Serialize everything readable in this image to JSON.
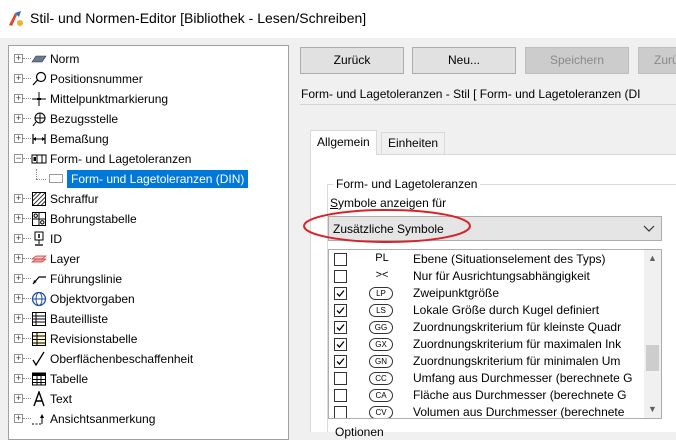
{
  "window": {
    "title": "Stil- und Normen-Editor [Bibliothek - Lesen/Schreiben]"
  },
  "toolbar": {
    "back_label": "Zurück",
    "new_label": "Neu...",
    "save_label": "Speichern",
    "reset_label": "Zurü"
  },
  "header": {
    "title": "Form- und Lagetoleranzen - Stil [ Form- und Lagetoleranzen (DI"
  },
  "tabs": [
    {
      "label": "Allgemein"
    },
    {
      "label": "Einheiten"
    }
  ],
  "group": {
    "legend": "Form- und Lagetoleranzen",
    "field_label": "Symbole anzeigen für",
    "field_label_underline": "S",
    "field_label_rest": "ymbole anzeigen für",
    "combo_value": "Zusätzliche Symbole"
  },
  "symbols": [
    {
      "symbol": "PL",
      "label": "Ebene (Situationselement des Typs)",
      "checked": false,
      "circled": false
    },
    {
      "symbol": "><",
      "label": "Nur für Ausrichtungsabhängigkeit",
      "checked": false,
      "circled": false
    },
    {
      "symbol": "LP",
      "label": "Zweipunktgröße",
      "checked": true,
      "circled": true
    },
    {
      "symbol": "LS",
      "label": "Lokale Größe durch Kugel definiert",
      "checked": true,
      "circled": true
    },
    {
      "symbol": "GG",
      "label": "Zuordnungskriterium für kleinste Quadr",
      "checked": true,
      "circled": true
    },
    {
      "symbol": "GX",
      "label": "Zuordnungskriterium für maximalen Ink",
      "checked": true,
      "circled": true
    },
    {
      "symbol": "GN",
      "label": "Zuordnungskriterium für minimalen Um",
      "checked": true,
      "circled": true
    },
    {
      "symbol": "CC",
      "label": "Umfang aus Durchmesser (berechnete G",
      "checked": false,
      "circled": true
    },
    {
      "symbol": "CA",
      "label": "Fläche aus Durchmesser (berechnete G",
      "checked": false,
      "circled": true
    },
    {
      "symbol": "CV",
      "label": "Volumen aus Durchmesser (berechnete",
      "checked": false,
      "circled": true
    }
  ],
  "bottom": {
    "next_group_label": "Optionen"
  },
  "tree": {
    "items": [
      {
        "label": "Norm",
        "icon": "norm-icon"
      },
      {
        "label": "Positionsnummer",
        "icon": "balloon-icon"
      },
      {
        "label": "Mittelpunktmarkierung",
        "icon": "centermark-icon"
      },
      {
        "label": "Bezugsstelle",
        "icon": "datum-target-icon"
      },
      {
        "label": "Bemaßung",
        "icon": "dimension-icon"
      },
      {
        "label": "Form- und Lagetoleranzen",
        "icon": "feature-control-frame-icon",
        "expanded": true
      },
      {
        "label": "Form- und Lagetoleranzen (DIN)",
        "icon": "style-icon",
        "child": true,
        "selected": true
      },
      {
        "label": "Schraffur",
        "icon": "hatch-icon"
      },
      {
        "label": "Bohrungstabelle",
        "icon": "hole-table-icon"
      },
      {
        "label": "ID",
        "icon": "id-icon"
      },
      {
        "label": "Layer",
        "icon": "layer-icon"
      },
      {
        "label": "Führungslinie",
        "icon": "leader-icon"
      },
      {
        "label": "Objektvorgaben",
        "icon": "object-defaults-icon"
      },
      {
        "label": "Bauteilliste",
        "icon": "parts-list-icon"
      },
      {
        "label": "Revisionstabelle",
        "icon": "revision-table-icon"
      },
      {
        "label": "Oberflächenbeschaffenheit",
        "icon": "surface-texture-icon"
      },
      {
        "label": "Tabelle",
        "icon": "table-icon"
      },
      {
        "label": "Text",
        "icon": "text-icon"
      },
      {
        "label": "Ansichtsanmerkung",
        "icon": "view-annotation-icon"
      }
    ]
  },
  "colors": {
    "selection": "#0078d7",
    "highlight_ellipse": "#d9232a"
  }
}
